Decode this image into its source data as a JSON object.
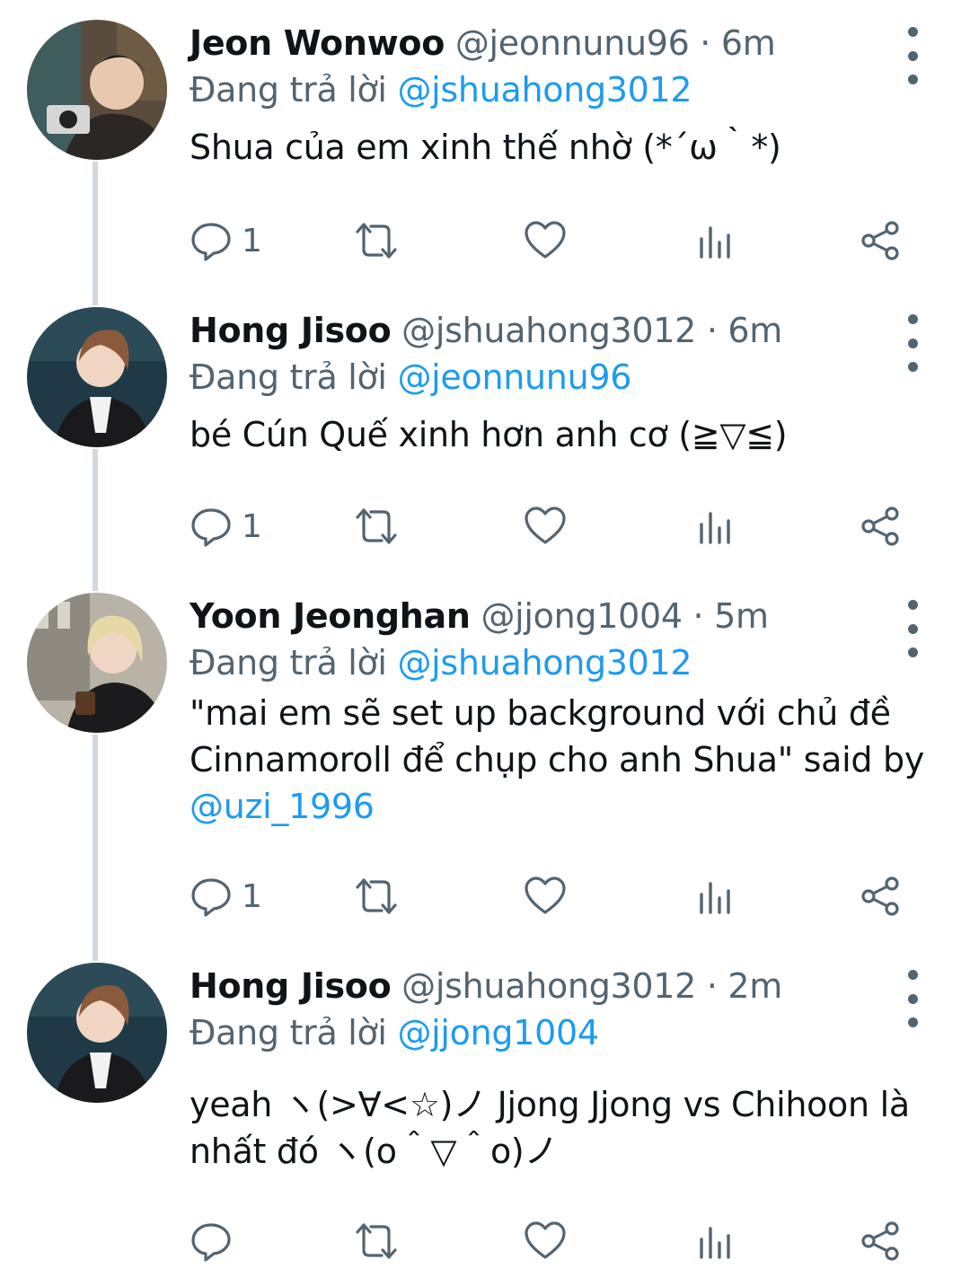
{
  "tweets": [
    {
      "name": "Jeon Wonwoo",
      "handle": "@jeonnunu96",
      "separator": "·",
      "time": "6m",
      "reply_prefix": "Đang trả lời",
      "reply_to": "@jshuahong3012",
      "text": "Shua của em xinh thế nhờ (*´ω｀*)",
      "reply_count": "1"
    },
    {
      "name": "Hong Jisoo",
      "handle": "@jshuahong3012",
      "separator": "·",
      "time": "6m",
      "reply_prefix": "Đang trả lời",
      "reply_to": "@jeonnunu96",
      "text": "bé Cún Quế xinh hơn anh cơ (≧▽≦)",
      "reply_count": "1"
    },
    {
      "name": "Yoon Jeonghan",
      "handle": "@jjong1004",
      "separator": "·",
      "time": "5m",
      "reply_prefix": "Đang trả lời",
      "reply_to": "@jshuahong3012",
      "text_before": "\"mai em sẽ set up background với chủ đề Cinnamoroll để chụp cho anh Shua\" said by ",
      "text_mention": "@uzi_1996",
      "reply_count": "1"
    },
    {
      "name": "Hong Jisoo",
      "handle": "@jshuahong3012",
      "separator": "·",
      "time": "2m",
      "reply_prefix": "Đang trả lời",
      "reply_to": "@jjong1004",
      "text": "yeah ヽ(>∀<☆)ノ Jjong Jjong vs Chihoon là nhất đó ヽ(o＾▽＾o)ノ",
      "reply_count": ""
    }
  ],
  "icons": [
    "reply-icon",
    "retweet-icon",
    "like-icon",
    "analytics-icon",
    "share-icon",
    "more-options-icon"
  ],
  "colors": {
    "text_primary": "#0f1419",
    "text_secondary": "#536471",
    "mention": "#1d9bf0",
    "thread_line": "#cfd9de"
  }
}
